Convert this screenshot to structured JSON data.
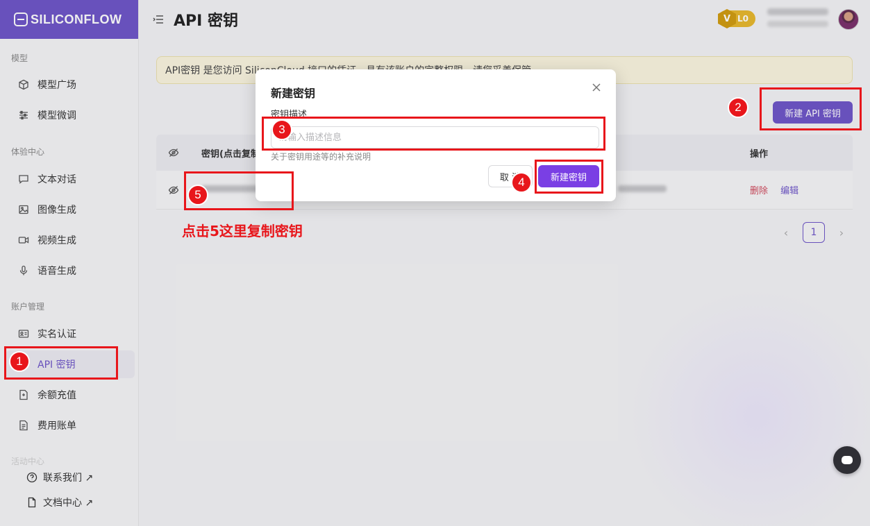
{
  "brand": {
    "logo_text": "SILICONFLOW"
  },
  "header": {
    "title": "API 密钥",
    "level": "L0",
    "level_icon": "V"
  },
  "sidebar": {
    "sections": [
      "模型",
      "体验中心",
      "账户管理",
      "活动中心"
    ],
    "items": [
      {
        "label": "模型广场",
        "icon": "cube-icon"
      },
      {
        "label": "模型微调",
        "icon": "sliders-icon"
      },
      {
        "label": "文本对话",
        "icon": "chat-icon"
      },
      {
        "label": "图像生成",
        "icon": "image-icon"
      },
      {
        "label": "视频生成",
        "icon": "video-icon"
      },
      {
        "label": "语音生成",
        "icon": "mic-icon"
      },
      {
        "label": "实名认证",
        "icon": "id-card-icon"
      },
      {
        "label": "API 密钥",
        "icon": "key-icon",
        "active": true
      },
      {
        "label": "余额充值",
        "icon": "wallet-icon"
      },
      {
        "label": "费用账单",
        "icon": "bill-icon"
      }
    ],
    "bottom_links": [
      {
        "label": "联系我们 ↗",
        "icon": "help-icon"
      },
      {
        "label": "文档中心 ↗",
        "icon": "doc-icon"
      }
    ]
  },
  "main": {
    "notice": "API密钥 是您访问 SiliconCloud 接口的凭证，具有该账户的完整权限，请您妥善保管。",
    "new_key_button": "新建 API 密钥",
    "table": {
      "headers": {
        "key": "密钥(点击复制)",
        "actions": "操作"
      },
      "row": {
        "delete": "删除",
        "edit": "编辑"
      }
    },
    "pagination": {
      "current": "1",
      "prev": "‹",
      "next": "›"
    }
  },
  "modal": {
    "title": "新建密钥",
    "field_label": "密钥描述",
    "placeholder": "请输入描述信息",
    "help_text": "关于密钥用途等的补充说明",
    "cancel": "取 消",
    "confirm": "新建密钥"
  },
  "annotations": {
    "numbers": [
      "1",
      "2",
      "3",
      "4",
      "5"
    ],
    "note": "点击5这里复制密钥"
  },
  "colors": {
    "brand": "#6e55c8",
    "confirm": "#7a3fe4",
    "annotation": "#e8161b",
    "delete": "#d0485b"
  }
}
